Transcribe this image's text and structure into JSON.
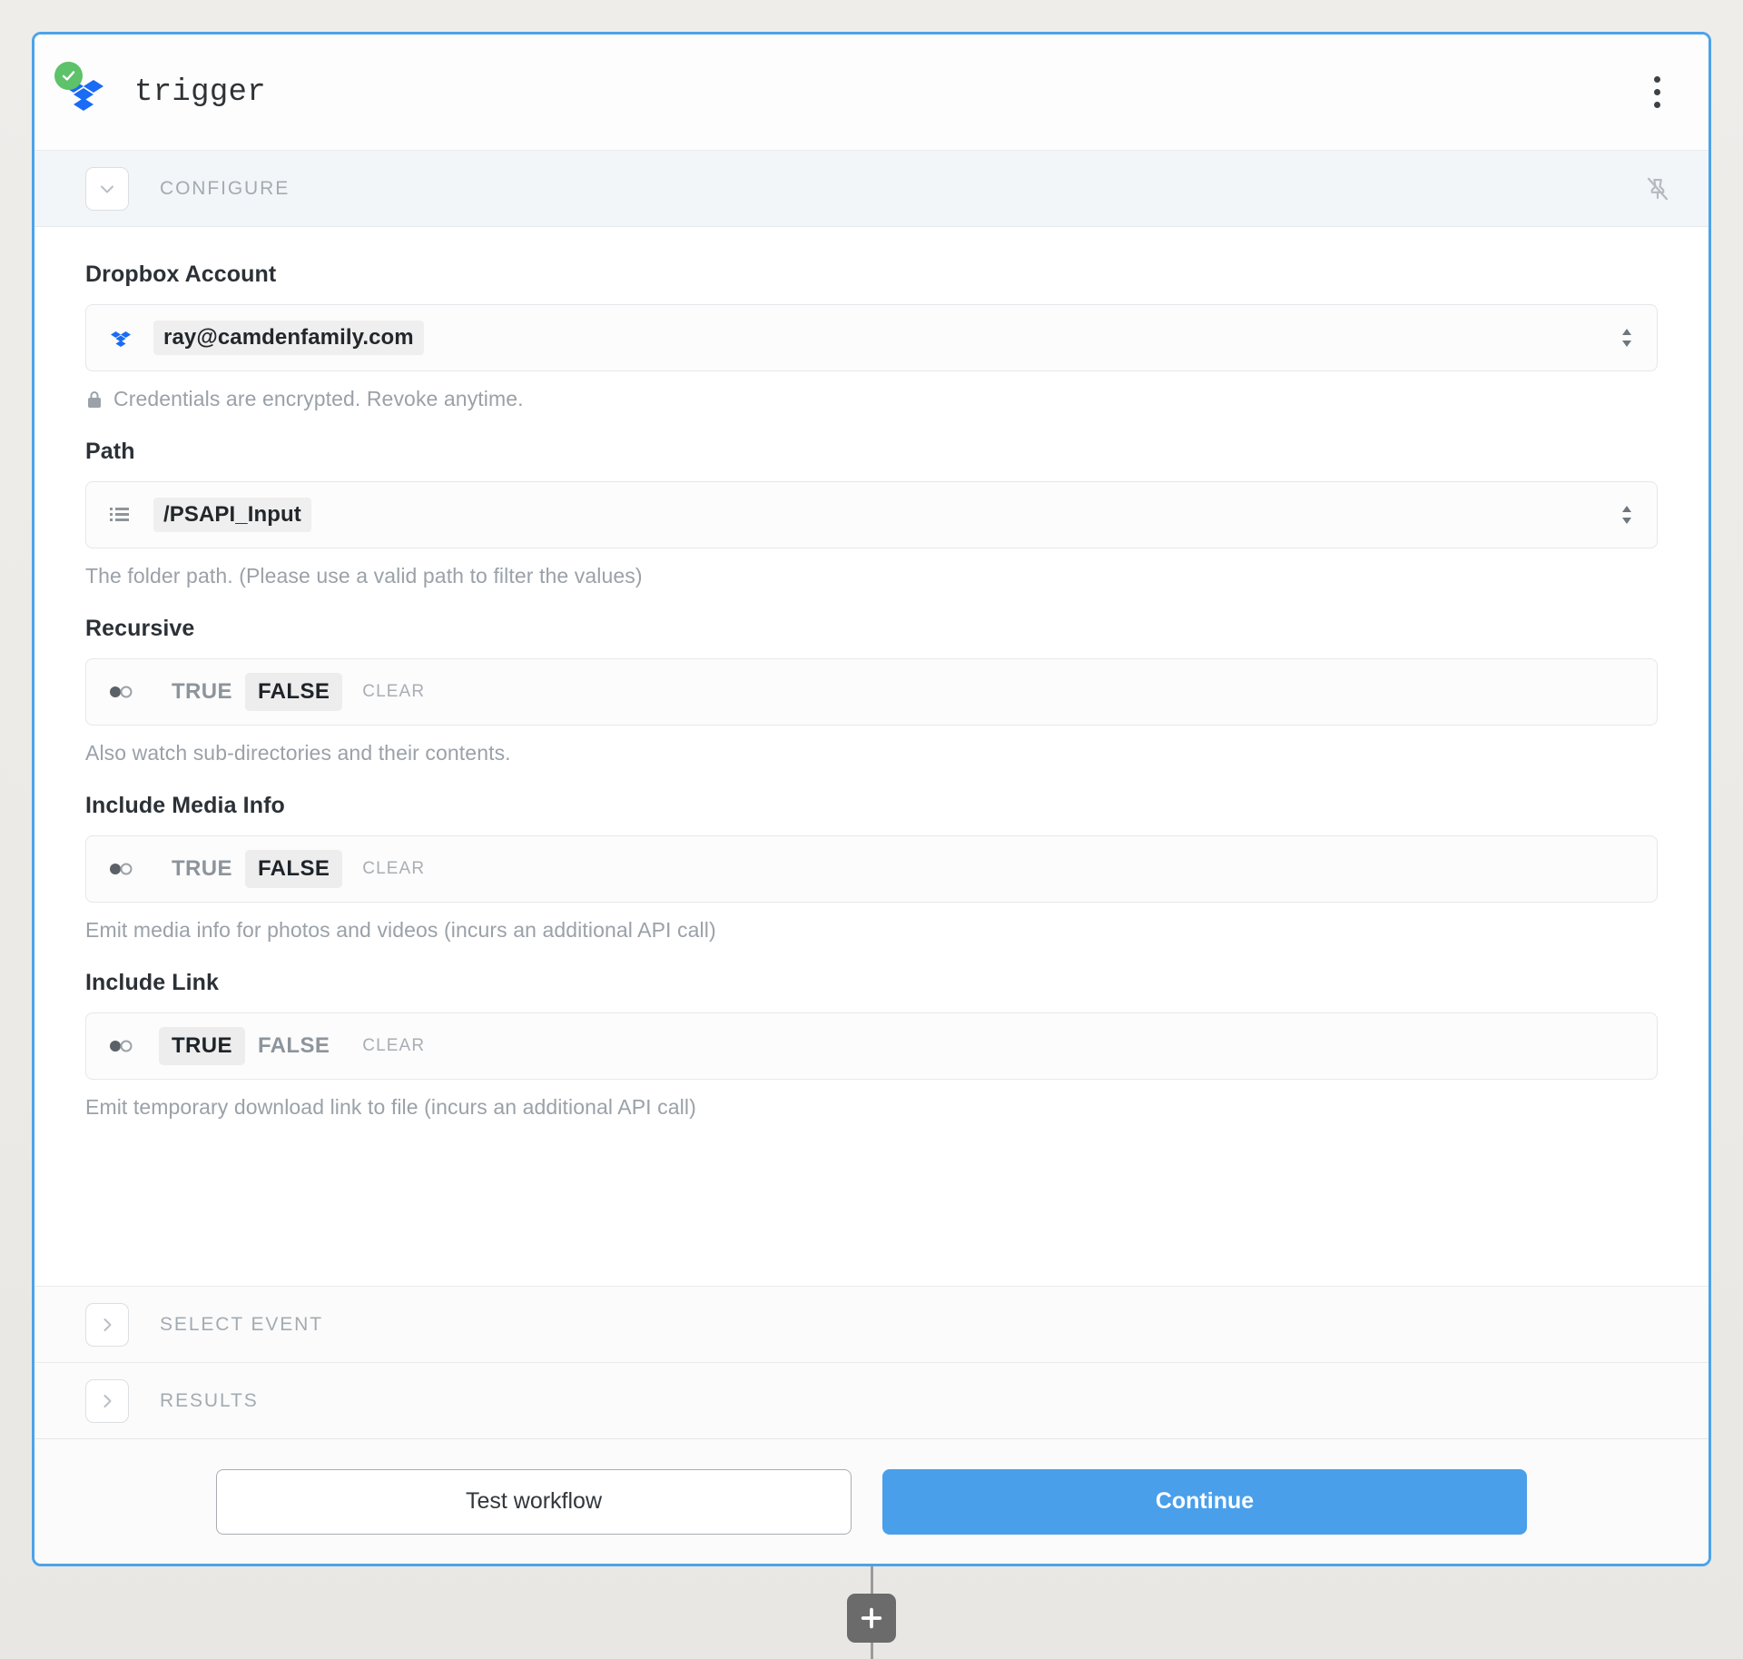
{
  "node": {
    "title": "trigger",
    "app_icon": "dropbox-icon",
    "status_icon": "check-circle-icon",
    "menu_icon": "kebab-menu-icon"
  },
  "sections": {
    "configure": {
      "label": "CONFIGURE",
      "expanded": true,
      "chevron_icon": "chevron-down-icon",
      "pin_icon": "pin-off-icon"
    },
    "select_event": {
      "label": "SELECT EVENT",
      "expanded": false,
      "chevron_icon": "chevron-right-icon"
    },
    "results": {
      "label": "RESULTS",
      "expanded": false,
      "chevron_icon": "chevron-right-icon"
    }
  },
  "fields": {
    "account": {
      "label": "Dropbox Account",
      "value": "ray@camdenfamily.com",
      "icon": "dropbox-icon",
      "select_icon": "select-updown-icon",
      "helper": "Credentials are encrypted. Revoke anytime.",
      "helper_icon": "lock-icon"
    },
    "path": {
      "label": "Path",
      "value": "/PSAPI_Input",
      "icon": "list-icon",
      "select_icon": "select-updown-icon",
      "helper": "The folder path. (Please use a valid path to filter the values)"
    },
    "recursive": {
      "label": "Recursive",
      "icon": "toggle-icon",
      "options": [
        "TRUE",
        "FALSE"
      ],
      "clear_label": "CLEAR",
      "selected": "FALSE",
      "helper": "Also watch sub-directories and their contents."
    },
    "include_media_info": {
      "label": "Include Media Info",
      "icon": "toggle-icon",
      "options": [
        "TRUE",
        "FALSE"
      ],
      "clear_label": "CLEAR",
      "selected": "FALSE",
      "helper": "Emit media info for photos and videos (incurs an additional API call)"
    },
    "include_link": {
      "label": "Include Link",
      "icon": "toggle-icon",
      "options": [
        "TRUE",
        "FALSE"
      ],
      "clear_label": "CLEAR",
      "selected": "TRUE",
      "helper": "Emit temporary download link to file (incurs an additional API call)"
    }
  },
  "footer": {
    "test_label": "Test workflow",
    "continue_label": "Continue"
  },
  "canvas": {
    "add_step_icon": "plus-icon"
  },
  "colors": {
    "card_border": "#4da3e8",
    "primary_button": "#4a9fea",
    "status_green": "#5dc269",
    "dropbox_blue": "#0061fe"
  }
}
